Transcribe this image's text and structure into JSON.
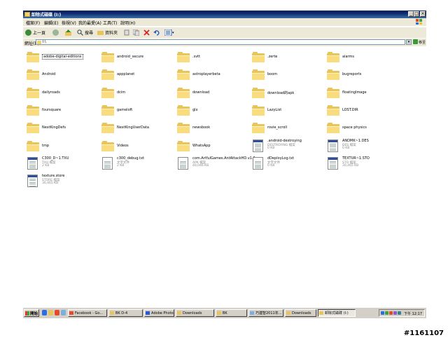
{
  "window": {
    "title": "卸除式磁碟 (I:)",
    "controls": [
      "_",
      "□",
      "×"
    ]
  },
  "menubar": {
    "items": [
      "檔案(F)",
      "編輯(E)",
      "檢視(V)",
      "我的最愛(A)",
      "工具(T)",
      "說明(H)"
    ]
  },
  "toolbar": {
    "back_label": "上一頁",
    "search_label": "搜尋",
    "folders_label": "資料夾"
  },
  "address": {
    "label": "網址(D)",
    "value": "I:\\",
    "go_label": "移至"
  },
  "files": [
    {
      "name": "adobe-digital-editions",
      "kind": "folder",
      "selected": true
    },
    {
      "name": "android_secure",
      "kind": "folder"
    },
    {
      "name": ".svtt",
      "kind": "folder"
    },
    {
      "name": ".zerte",
      "kind": "folder"
    },
    {
      "name": "alarms",
      "kind": "folder"
    },
    {
      "name": "Android",
      "kind": "folder"
    },
    {
      "name": "appplanet",
      "kind": "folder"
    },
    {
      "name": "astroplayerbeta",
      "kind": "folder"
    },
    {
      "name": "boom",
      "kind": "folder"
    },
    {
      "name": "bugreports",
      "kind": "folder"
    },
    {
      "name": "dailyroads",
      "kind": "folder"
    },
    {
      "name": "dcim",
      "kind": "folder"
    },
    {
      "name": "download",
      "kind": "folder"
    },
    {
      "name": "download的apk",
      "kind": "folder"
    },
    {
      "name": "floatingImage",
      "kind": "folder"
    },
    {
      "name": "foursquare",
      "kind": "folder"
    },
    {
      "name": "gameloft",
      "kind": "folder"
    },
    {
      "name": "glx",
      "kind": "folder"
    },
    {
      "name": "LazyList",
      "kind": "folder"
    },
    {
      "name": "LOST.DIR",
      "kind": "folder"
    },
    {
      "name": "NextKingDefs",
      "kind": "folder"
    },
    {
      "name": "NextKingUserData",
      "kind": "folder"
    },
    {
      "name": "newsbook",
      "kind": "folder"
    },
    {
      "name": "rovie_scroll",
      "kind": "folder"
    },
    {
      "name": "space physics",
      "kind": "folder"
    },
    {
      "name": "tmp",
      "kind": "folder"
    },
    {
      "name": "Videos",
      "kind": "folder"
    },
    {
      "name": "WhatsApp",
      "kind": "folder"
    },
    {
      "name": ".android-destroying",
      "kind": "file",
      "icon": "dll",
      "type": "DESTROYING 檔案",
      "size": "0 KB"
    },
    {
      "name": "ANDMK~1.DES",
      "kind": "file",
      "icon": "dll",
      "type": "DES 檔案",
      "size": "0 KB"
    },
    {
      "name": "C300_D~1.TXU",
      "kind": "file",
      "icon": "dll",
      "type": "TXU 檔案",
      "size": "2 KB"
    },
    {
      "name": "c300_debug.txt",
      "kind": "file",
      "icon": "txt",
      "type": "文字文件",
      "size": "2 KB"
    },
    {
      "name": "com.ArtfulGames.AntAttackHD.v1.0...",
      "kind": "file",
      "icon": "txt",
      "type": "APK 檔案",
      "size": "40,046 KB"
    },
    {
      "name": "dDeployLog.txt",
      "kind": "file",
      "icon": "txt",
      "type": "文字文件",
      "size": "0 KB"
    },
    {
      "name": "TEXTUR~1.STO",
      "kind": "file",
      "icon": "dll",
      "type": "STO 檔案",
      "size": "30,465 KB"
    },
    {
      "name": "texture.store",
      "kind": "file",
      "icon": "dll",
      "type": "STORE 檔案",
      "size": "30,465 KB"
    }
  ],
  "taskbar": {
    "start_label": "開始",
    "tasks": [
      {
        "label": "Facebook - Go...",
        "active": false
      },
      {
        "label": "BK D-4",
        "active": false
      },
      {
        "label": "Adobe Photosh...",
        "active": false
      },
      {
        "label": "Downloads",
        "active": false
      },
      {
        "label": "BK",
        "active": false
      },
      {
        "label": "巧連智2011年...",
        "active": false
      },
      {
        "label": "Downloads",
        "active": false
      },
      {
        "label": "卸除式磁碟 (I:)",
        "active": true
      }
    ],
    "clock": "下午 12:17"
  },
  "watermark": "#1161107",
  "colors": {
    "titlebar": "#0a246a",
    "folder": "#f8dc7e",
    "chrome": "#ece9d8"
  }
}
